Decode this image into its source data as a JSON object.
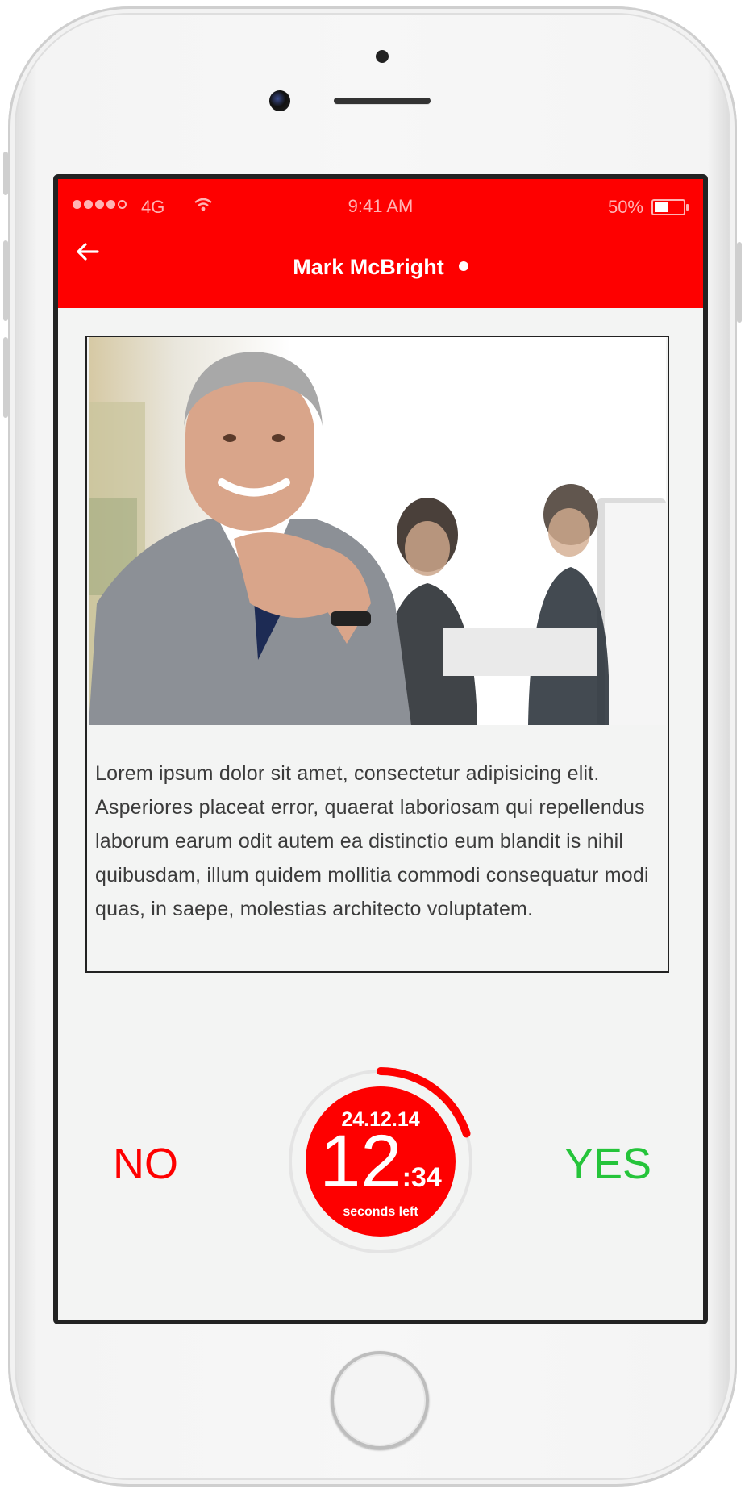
{
  "status_bar": {
    "signal_dots_filled": 4,
    "signal_dots_total": 5,
    "network": "4G",
    "time": "9:41 AM",
    "battery": "50%",
    "battery_level": 0.5
  },
  "header": {
    "back_icon": "arrow-left-icon",
    "title": "Mark McBright",
    "online": true,
    "color": "#fe0000"
  },
  "profile": {
    "photo_alt": "",
    "bio": "Lorem ipsum dolor sit amet, consectetur adipisicing elit. Asperiores placeat error, quaerat laboriosam qui repellendus laborum earum odit autem ea distinctio eum blandit is nihil quibusdam, illum quidem mollitia commodi consequatur modi quas, in saepe, molestias architecto voluptatem."
  },
  "actions": {
    "no_label": "NO",
    "yes_label": "YES",
    "no_color": "#fe0000",
    "yes_color": "#25c43a"
  },
  "countdown": {
    "date": "24.12.14",
    "seconds": "12",
    "fraction": ":34",
    "label": "seconds left",
    "progress": 0.2,
    "color": "#fe0000"
  }
}
